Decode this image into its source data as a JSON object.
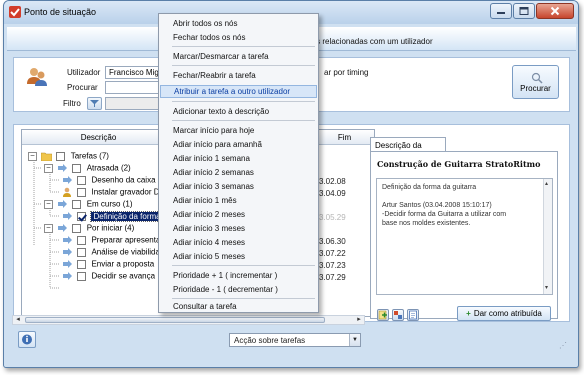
{
  "window": {
    "title": "Ponto de situação"
  },
  "banner": {
    "text": "efas relacionadas com um utilizador"
  },
  "filter": {
    "utilizador_label": "Utilizador",
    "utilizador_value": "Francisco Miguel",
    "procurar_label": "Procurar",
    "procurar_value": "",
    "filtro_label": "Filtro",
    "timing_text": "ar por timing",
    "search_button": "Procurar"
  },
  "tree": {
    "columns": {
      "descricao": "Descrição",
      "fim": "Fim"
    },
    "rows": [
      {
        "label": "Tarefas (7)",
        "date": ""
      },
      {
        "label": "Atrasada (2)",
        "date": ""
      },
      {
        "label": "Desenho da caixa",
        "date": "3.02.08"
      },
      {
        "label": "Instalar gravador DV",
        "date": "3.04.09"
      },
      {
        "label": "Em curso (1)",
        "date": ""
      },
      {
        "label": "Definição da forma",
        "date": "3.05.29"
      },
      {
        "label": "Por iniciar (4)",
        "date": ""
      },
      {
        "label": "Preparar apresentaç",
        "date": "3.06.30"
      },
      {
        "label": "Análise de viabilidad",
        "date": "3.07.22"
      },
      {
        "label": "Enviar a proposta",
        "date": "3.07.23"
      },
      {
        "label": "Decidir se avança",
        "date": "3.07.29"
      }
    ]
  },
  "detail": {
    "tab_label": "Descrição da Tarefa",
    "title": "Construção de Guitarra StratoRitmo",
    "description_line": "Definição da forma da guitarra",
    "author_line": "Artur Santos (03.04.2008 15:10:17)",
    "note_line1": "-Decidir forma da Guitarra a utilizar com",
    "note_line2": "base nos moldes existentes.",
    "assign_button": "Dar como atribuída"
  },
  "bottom": {
    "accao_select": "Acção sobre tarefas"
  },
  "context_menu": {
    "items": [
      "Abrir todos os nós",
      "Fechar todos os nós",
      "Marcar/Desmarcar a tarefa",
      "Fechar/Reabrir a tarefa",
      "Atribuir a tarefa a outro utilizador",
      "Adicionar texto à descrição",
      "Marcar início para hoje",
      "Adiar início para amanhã",
      "Adiar início 1 semana",
      "Adiar início 2 semanas",
      "Adiar início 3 semanas",
      "Adiar início 1 mês",
      "Adiar início 2 meses",
      "Adiar início 3 meses",
      "Adiar início 4 meses",
      "Adiar início 5 meses",
      "Prioridade + 1  ( incrementar )",
      "Prioridade - 1  ( decrementar )",
      "Consultar a tarefa"
    ],
    "highlighted_index": 4
  },
  "colors": {
    "window_bg": "#cfe0f1",
    "selection": "#0a246a",
    "menu_highlight": "#d7e6f8"
  }
}
